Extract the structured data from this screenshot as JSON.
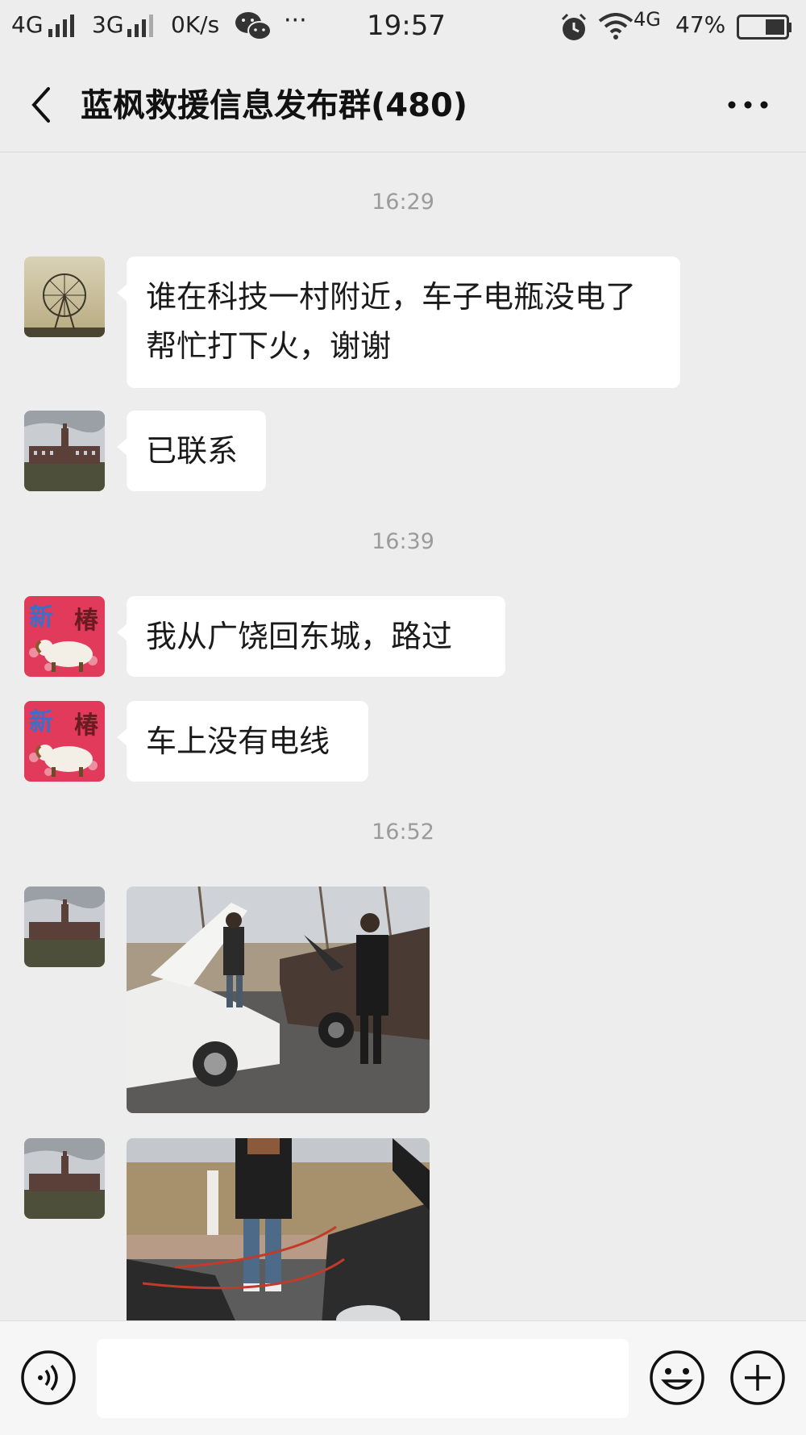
{
  "status_bar": {
    "network_left": "4G",
    "network_mid": "3G",
    "speed": "0K/s",
    "more": "···",
    "time": "19:57",
    "network_right": "4G",
    "battery": "47%"
  },
  "nav": {
    "title": "蓝枫救援信息发布群(480)"
  },
  "messages": [
    {
      "time": "16:29"
    },
    {
      "text": "谁在科技一村附近，车子电瓶没电了帮忙打下火，谢谢"
    },
    {
      "text": "已联系"
    },
    {
      "time": "16:39"
    },
    {
      "text": "我从广饶回东城，路过"
    },
    {
      "text": "车上没有电线"
    },
    {
      "time": "16:52"
    }
  ],
  "avatar_stamp": {
    "line1": "新",
    "line2": "椿"
  },
  "input": {
    "placeholder": ""
  },
  "colors": {
    "background": "#ededed",
    "bubble": "#ffffff",
    "timestamp": "#9b9b9b"
  },
  "icons": [
    "back-icon",
    "more-icon",
    "wechat-icon",
    "alarm-icon",
    "wifi-icon",
    "battery-icon",
    "voice-icon",
    "emoji-icon",
    "plus-icon"
  ]
}
